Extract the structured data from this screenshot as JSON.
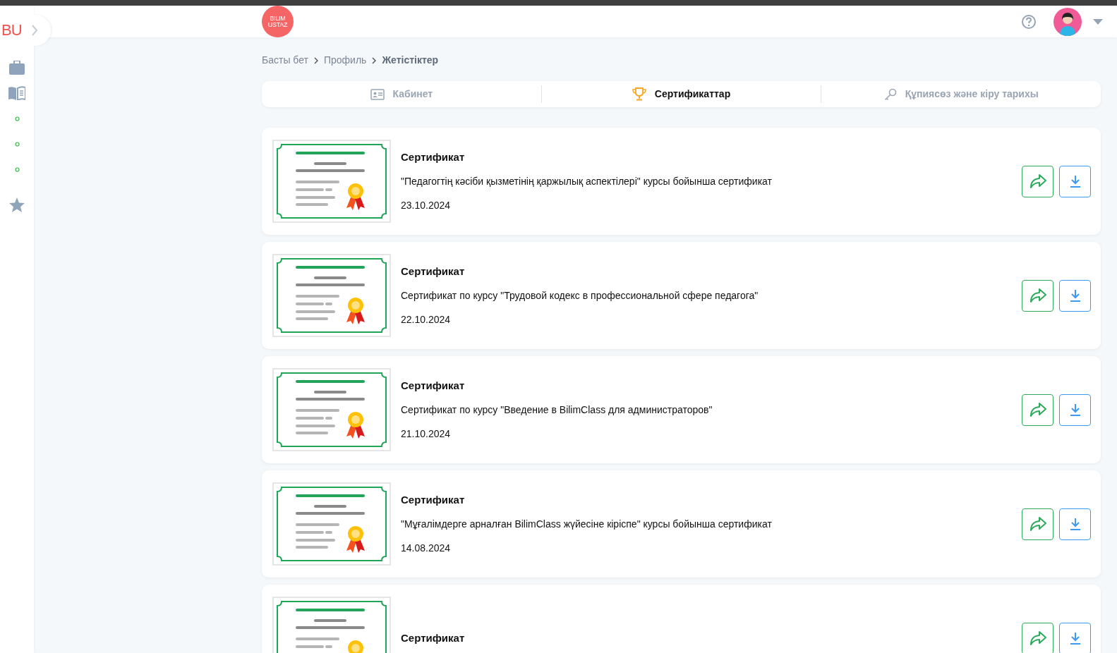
{
  "sidebar": {
    "logo": "BU",
    "items": [
      {
        "kind": "briefcase"
      },
      {
        "kind": "book"
      },
      {
        "kind": "dot"
      },
      {
        "kind": "dot"
      },
      {
        "kind": "dot"
      },
      {
        "kind": "star"
      }
    ]
  },
  "header": {
    "logo_lines": [
      "BILIM",
      "USTAZ"
    ]
  },
  "breadcrumbs": [
    {
      "label": "Басты бет",
      "current": false
    },
    {
      "label": "Профиль",
      "current": false
    },
    {
      "label": "Жетістіктер",
      "current": true
    }
  ],
  "tabs": [
    {
      "label": "Кабинет",
      "kind": "profile",
      "selected": false
    },
    {
      "label": "Сертификаттар",
      "kind": "awards",
      "selected": true
    },
    {
      "label": "Құпиясөз және кіру тарихы",
      "kind": "security",
      "selected": false
    }
  ],
  "certificates": [
    {
      "title": "Сертификат",
      "description": "\"Педагогтің кәсіби қызметінің қаржылық аспектілері\" курсы бойынша сертификат",
      "date": "23.10.2024"
    },
    {
      "title": "Сертификат",
      "description": "Сертификат по курсу \"Трудовой кодекс в профессиональной сфере педагога\"",
      "date": "22.10.2024"
    },
    {
      "title": "Сертификат",
      "description": "Сертификат по курсу \"Введение в BilimClass для администраторов\"",
      "date": "21.10.2024"
    },
    {
      "title": "Сертификат",
      "description": "\"Мұғалімдерге арналған BilimClass жүйесіне кіріспе\" курсы бойынша сертификат",
      "date": "14.08.2024"
    },
    {
      "title": "Сертификат"
    }
  ]
}
